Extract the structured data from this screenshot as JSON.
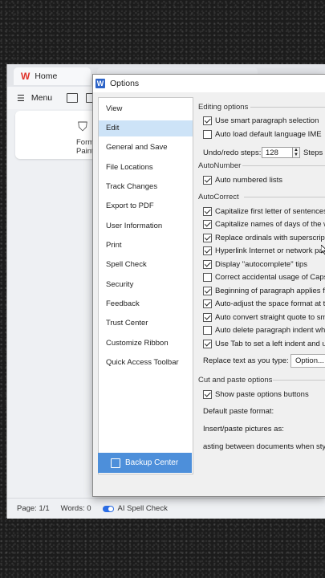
{
  "app": {
    "home_tab": "Home",
    "menu_label": "Menu",
    "format_painter": "Format\nPainter"
  },
  "status": {
    "page": "Page: 1/1",
    "words": "Words: 0",
    "spell": "AI Spell Check"
  },
  "dialog": {
    "title": "Options",
    "nav": [
      "View",
      "Edit",
      "General and Save",
      "File Locations",
      "Track Changes",
      "Export to PDF",
      "User Information",
      "Print",
      "Spell Check",
      "Security",
      "Feedback",
      "Trust Center",
      "Customize Ribbon",
      "Quick Access Toolbar"
    ],
    "selected": "Edit",
    "backup": "Backup Center",
    "editing": {
      "header": "Editing options",
      "smart_paragraph": "Use smart paragraph selection",
      "auto_load_ime": "Auto load default language IME",
      "undo_label": "Undo/redo steps:",
      "undo_value": "128",
      "steps_suffix": "Steps"
    },
    "autonumber": {
      "header": "AutoNumber",
      "lists": "Auto numbered lists"
    },
    "autocorrect": {
      "header": "AutoCorrect",
      "items": [
        {
          "label": "Capitalize first letter of sentences",
          "checked": true
        },
        {
          "label": "Capitalize names of days of the w",
          "checked": true
        },
        {
          "label": "Replace ordinals with superscript",
          "checked": true
        },
        {
          "label": "Hyperlink Internet or network path",
          "checked": true
        },
        {
          "label": "Display \"autocomplete\" tips",
          "checked": true
        },
        {
          "label": "Correct accidental usage of Caps",
          "checked": false
        },
        {
          "label": "Beginning of paragraph applies fir",
          "checked": true
        },
        {
          "label": "Auto-adjust the space format at t",
          "checked": true
        },
        {
          "label": "Auto convert straight quote to sm",
          "checked": true
        },
        {
          "label": "Auto delete paragraph indent whe",
          "checked": false
        },
        {
          "label": "Use Tab to set a left indent and us",
          "checked": true
        }
      ],
      "replace_label": "Replace text as you type:",
      "option_button": "Option..."
    },
    "cutpaste": {
      "header": "Cut and paste options",
      "show_buttons": "Show paste options buttons",
      "default_format": "Default paste format:",
      "insert_pictures": "Insert/paste pictures as:",
      "between_docs": "asting between documents when styl"
    }
  }
}
